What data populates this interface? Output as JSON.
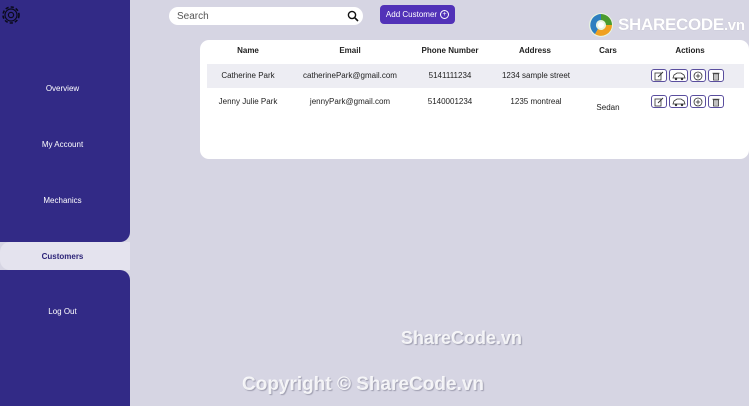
{
  "sidebar": {
    "items": [
      {
        "label": "Overview"
      },
      {
        "label": "My Account"
      },
      {
        "label": "Mechanics"
      },
      {
        "label": "Customers"
      },
      {
        "label": "Log Out"
      }
    ],
    "active": "Customers"
  },
  "search": {
    "placeholder": "Search",
    "value": ""
  },
  "toolbar": {
    "add_label": "Add Customer"
  },
  "logo": {
    "text": "SHARECODE",
    "suffix": ".vn"
  },
  "table": {
    "columns": [
      "Name",
      "Email",
      "Phone Number",
      "Address",
      "Cars",
      "Actions"
    ],
    "rows": [
      {
        "name": "Catherine Park",
        "email": "catherinePark@gmail.com",
        "phone": "5141111234",
        "address": "1234 sample street",
        "cars": ""
      },
      {
        "name": "Jenny Julie Park",
        "email": "jennyPark@gmail.com",
        "phone": "5140001234",
        "address": "1235 montreal",
        "cars": "Sedan"
      }
    ]
  },
  "watermarks": {
    "center": "ShareCode.vn",
    "bottom": "Copyright © ShareCode.vn"
  },
  "colors": {
    "sidebar": "#322a86",
    "accent": "#5232b8",
    "background": "#d6d5e3"
  }
}
